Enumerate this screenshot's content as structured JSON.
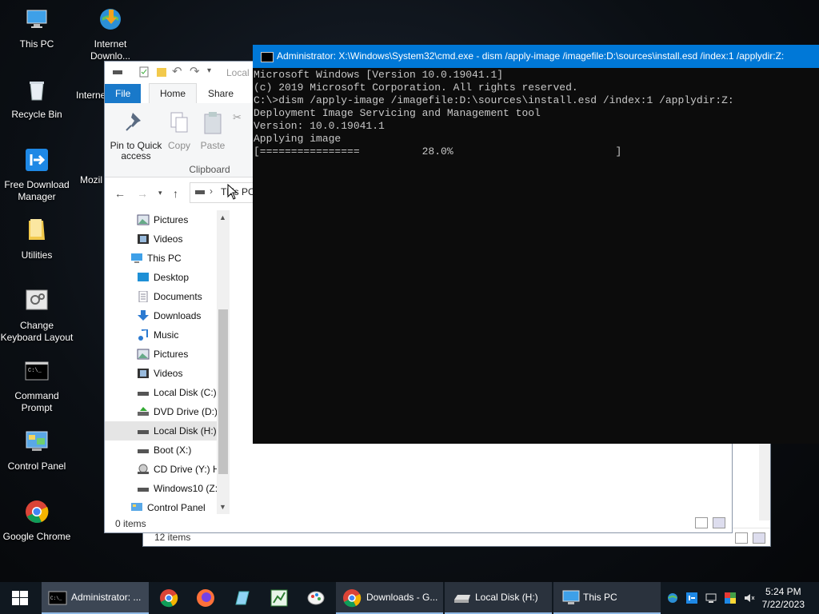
{
  "desktop": {
    "icons": [
      {
        "label": "This PC"
      },
      {
        "label": "Internet Downlo..."
      },
      {
        "label": "Recycle Bin"
      },
      {
        "label": "Interne"
      },
      {
        "label": "Free Download Manager"
      },
      {
        "label": "Mozil"
      },
      {
        "label": "Utilities"
      },
      {
        "label": "Change Keyboard Layout"
      },
      {
        "label": "Command Prompt"
      },
      {
        "label": "Control Panel"
      },
      {
        "label": "Google Chrome"
      }
    ]
  },
  "back_window": {
    "status_text": "12 items"
  },
  "explorer": {
    "title_partial": "Local",
    "tabs": {
      "file": "File",
      "home": "Home",
      "share": "Share"
    },
    "ribbon": {
      "pin_label": "Pin to Quick access",
      "copy_label": "Copy",
      "paste_label": "Paste",
      "group_label": "Clipboard"
    },
    "address": {
      "crumb": "This PC"
    },
    "nav_items": [
      {
        "label": "Pictures"
      },
      {
        "label": "Videos"
      },
      {
        "label": "This PC"
      },
      {
        "label": "Desktop"
      },
      {
        "label": "Documents"
      },
      {
        "label": "Downloads"
      },
      {
        "label": "Music"
      },
      {
        "label": "Pictures"
      },
      {
        "label": "Videos"
      },
      {
        "label": "Local Disk (C:)"
      },
      {
        "label": "DVD Drive (D:)"
      },
      {
        "label": "Local Disk (H:)"
      },
      {
        "label": "Boot (X:)"
      },
      {
        "label": "CD Drive (Y:) H"
      },
      {
        "label": "Windows10 (Z:"
      },
      {
        "label": "Control Panel"
      }
    ],
    "status_text": "0 items"
  },
  "cmd": {
    "title": "Administrator: X:\\Windows\\System32\\cmd.exe - dism  /apply-image /imagefile:D:\\sources\\install.esd /index:1 /applydir:Z:",
    "lines": [
      "Microsoft Windows [Version 10.0.19041.1]",
      "(c) 2019 Microsoft Corporation. All rights reserved.",
      "",
      "C:\\>dism /apply-image /imagefile:D:\\sources\\install.esd /index:1 /applydir:Z:",
      "",
      "Deployment Image Servicing and Management tool",
      "Version: 10.0.19041.1",
      "",
      "Applying image",
      "[================          28.0%                          ]"
    ],
    "progress_percent": 28.0
  },
  "taskbar": {
    "cmd_label": "Administrator: ...",
    "chrome_label": "Downloads - G...",
    "localdisk_label": "Local Disk (H:)",
    "thispc_label": "This PC",
    "time": "5:24 PM",
    "date": "7/22/2023"
  },
  "colors": {
    "accent": "#0078d7",
    "file_tab": "#1979ca",
    "selection": "#cce8ff"
  }
}
